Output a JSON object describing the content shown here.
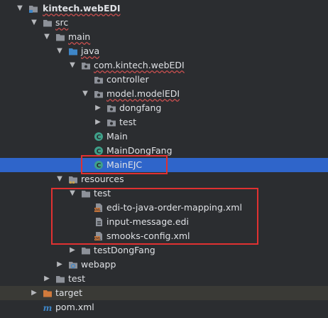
{
  "tree": [
    {
      "label": "kintech.webEDI",
      "icon": "project-folder-icon",
      "expanded": true,
      "bold": true,
      "squiggle": true
    },
    {
      "label": "src",
      "icon": "folder-icon",
      "expanded": true,
      "squiggle": true
    },
    {
      "label": "main",
      "icon": "folder-icon",
      "expanded": true,
      "squiggle": true
    },
    {
      "label": "java",
      "icon": "source-folder-icon",
      "expanded": true,
      "squiggle": true
    },
    {
      "label": "com.kintech.webEDI",
      "icon": "package-icon",
      "expanded": true,
      "squiggle": true
    },
    {
      "label": "controller",
      "icon": "package-icon"
    },
    {
      "label": "model.modelEDI",
      "icon": "package-icon",
      "expanded": true,
      "squiggle": true
    },
    {
      "label": "dongfang",
      "icon": "package-icon",
      "expanded": false
    },
    {
      "label": "test",
      "icon": "package-icon",
      "expanded": false
    },
    {
      "label": "Main",
      "icon": "java-class-icon"
    },
    {
      "label": "MainDongFang",
      "icon": "java-class-icon"
    },
    {
      "label": "MainEJC",
      "icon": "java-class-icon",
      "selected": true
    },
    {
      "label": "resources",
      "icon": "resources-folder-icon",
      "expanded": true
    },
    {
      "label": "test",
      "icon": "folder-icon",
      "expanded": true
    },
    {
      "label": "edi-to-java-order-mapping.xml",
      "icon": "xml-file-icon"
    },
    {
      "label": "input-message.edi",
      "icon": "text-file-icon"
    },
    {
      "label": "smooks-config.xml",
      "icon": "xml-file-icon"
    },
    {
      "label": "testDongFang",
      "icon": "folder-icon",
      "expanded": false
    },
    {
      "label": "webapp",
      "icon": "web-folder-icon",
      "expanded": false
    },
    {
      "label": "test",
      "icon": "folder-icon",
      "expanded": false
    },
    {
      "label": "target",
      "icon": "excluded-folder-icon",
      "expanded": false,
      "excluded": true,
      "highlighted": true
    },
    {
      "label": "pom.xml",
      "icon": "maven-file-icon"
    }
  ],
  "colors": {
    "background": "#2b2d30",
    "selection": "#2f65ca",
    "annotation_box": "#e03131",
    "folder": "#8d9199",
    "source_folder": "#3e86c8",
    "java_class": "#3fa18a",
    "excluded": "#d17a3c"
  }
}
